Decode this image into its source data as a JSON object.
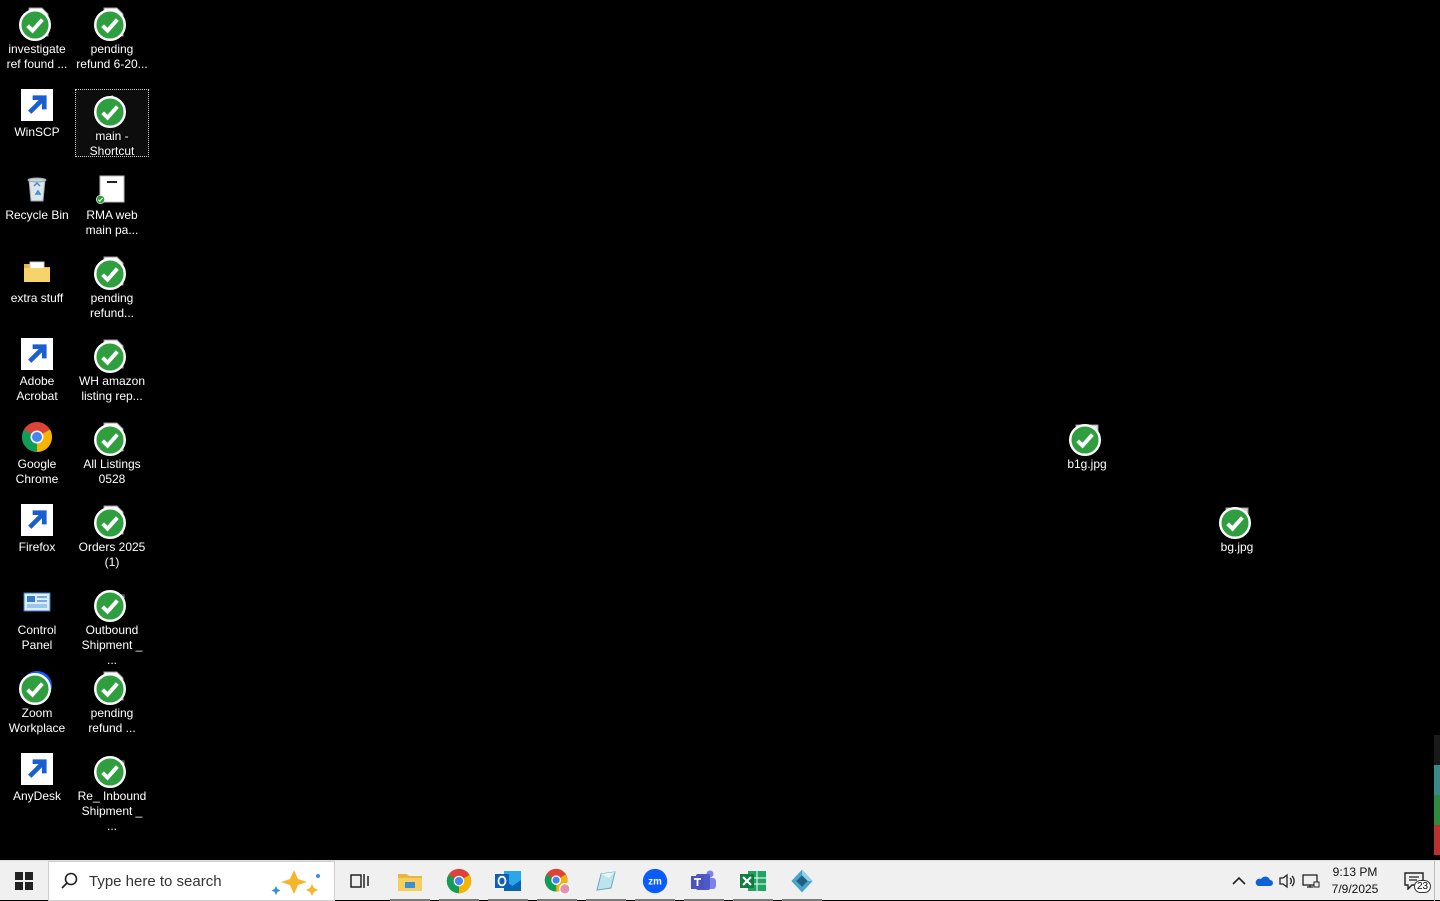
{
  "desktop": {
    "icons": [
      {
        "label": "investigate\nref found ...",
        "icon": "excel-file-icon",
        "sync": true
      },
      {
        "label": "pending\nrefund 6-20...",
        "icon": "excel-file-icon",
        "sync": true
      },
      {
        "label": "WinSCP",
        "icon": "winscp-icon",
        "shortcut": true
      },
      {
        "label": "main -\nShortcut",
        "icon": "app-shortcut-icon",
        "sync": true,
        "selected": true
      },
      {
        "label": "Recycle Bin",
        "icon": "recycle-bin-icon"
      },
      {
        "label": "RMA web\nmain pa...",
        "icon": "web-page-icon",
        "sync": true
      },
      {
        "label": "extra stuff",
        "icon": "folder-icon"
      },
      {
        "label": "pending\nrefund...",
        "icon": "excel-file-icon",
        "sync": true
      },
      {
        "label": "Adobe\nAcrobat",
        "icon": "adobe-acrobat-icon",
        "shortcut": true
      },
      {
        "label": "WH amazon\nlisting rep...",
        "icon": "excel-file-icon",
        "sync": true
      },
      {
        "label": "Google\nChrome",
        "icon": "chrome-icon"
      },
      {
        "label": "All Listings\n0528",
        "icon": "excel-file-icon",
        "sync": true
      },
      {
        "label": "Firefox",
        "icon": "firefox-icon",
        "shortcut": true
      },
      {
        "label": "Orders 2025\n(1)",
        "icon": "excel-file-icon",
        "sync": true
      },
      {
        "label": "Control\nPanel",
        "icon": "control-panel-icon"
      },
      {
        "label": "Outbound\nShipment _ ...",
        "icon": "mail-message-icon",
        "sync": true
      },
      {
        "label": "Zoom\nWorkplace",
        "icon": "zoom-icon",
        "sync": true
      },
      {
        "label": "pending\nrefund ...",
        "icon": "excel-file-icon",
        "sync": true
      },
      {
        "label": "AnyDesk",
        "icon": "anydesk-icon",
        "shortcut": true
      },
      {
        "label": "Re_ Inbound\nShipment _ ...",
        "icon": "mail-message-icon",
        "sync": true
      },
      {
        "label": "b1g.jpg",
        "icon": "image-file-icon",
        "sync": true
      },
      {
        "label": "bg.jpg",
        "icon": "image-file-icon",
        "sync": true
      }
    ]
  },
  "taskbar": {
    "search_placeholder": "Type here to search",
    "apps": [
      {
        "name": "task-view",
        "icon": "task-view-icon"
      },
      {
        "name": "file-explorer",
        "icon": "file-explorer-icon",
        "running": true
      },
      {
        "name": "chrome",
        "icon": "chrome-icon",
        "running": true
      },
      {
        "name": "outlook",
        "icon": "outlook-icon",
        "running": true
      },
      {
        "name": "chrome-profile",
        "icon": "chrome-profile-icon",
        "running": true
      },
      {
        "name": "notepad-app",
        "icon": "app-pen-icon",
        "running": true
      },
      {
        "name": "zoom",
        "icon": "zoom-icon",
        "running": true
      },
      {
        "name": "teams",
        "icon": "teams-icon",
        "running": true
      },
      {
        "name": "excel",
        "icon": "excel-icon",
        "running": true
      },
      {
        "name": "app-shortcut",
        "icon": "app-shortcut-icon",
        "running": true
      }
    ],
    "clock": {
      "time": "9:13 PM",
      "date": "7/9/2025"
    },
    "notifications_count": "23"
  },
  "colors": {
    "desktop_bg": "#000000",
    "taskbar_bg": "#f0f0f0",
    "excel_green": "#1d7044",
    "sync_green": "#2e9e3e"
  }
}
